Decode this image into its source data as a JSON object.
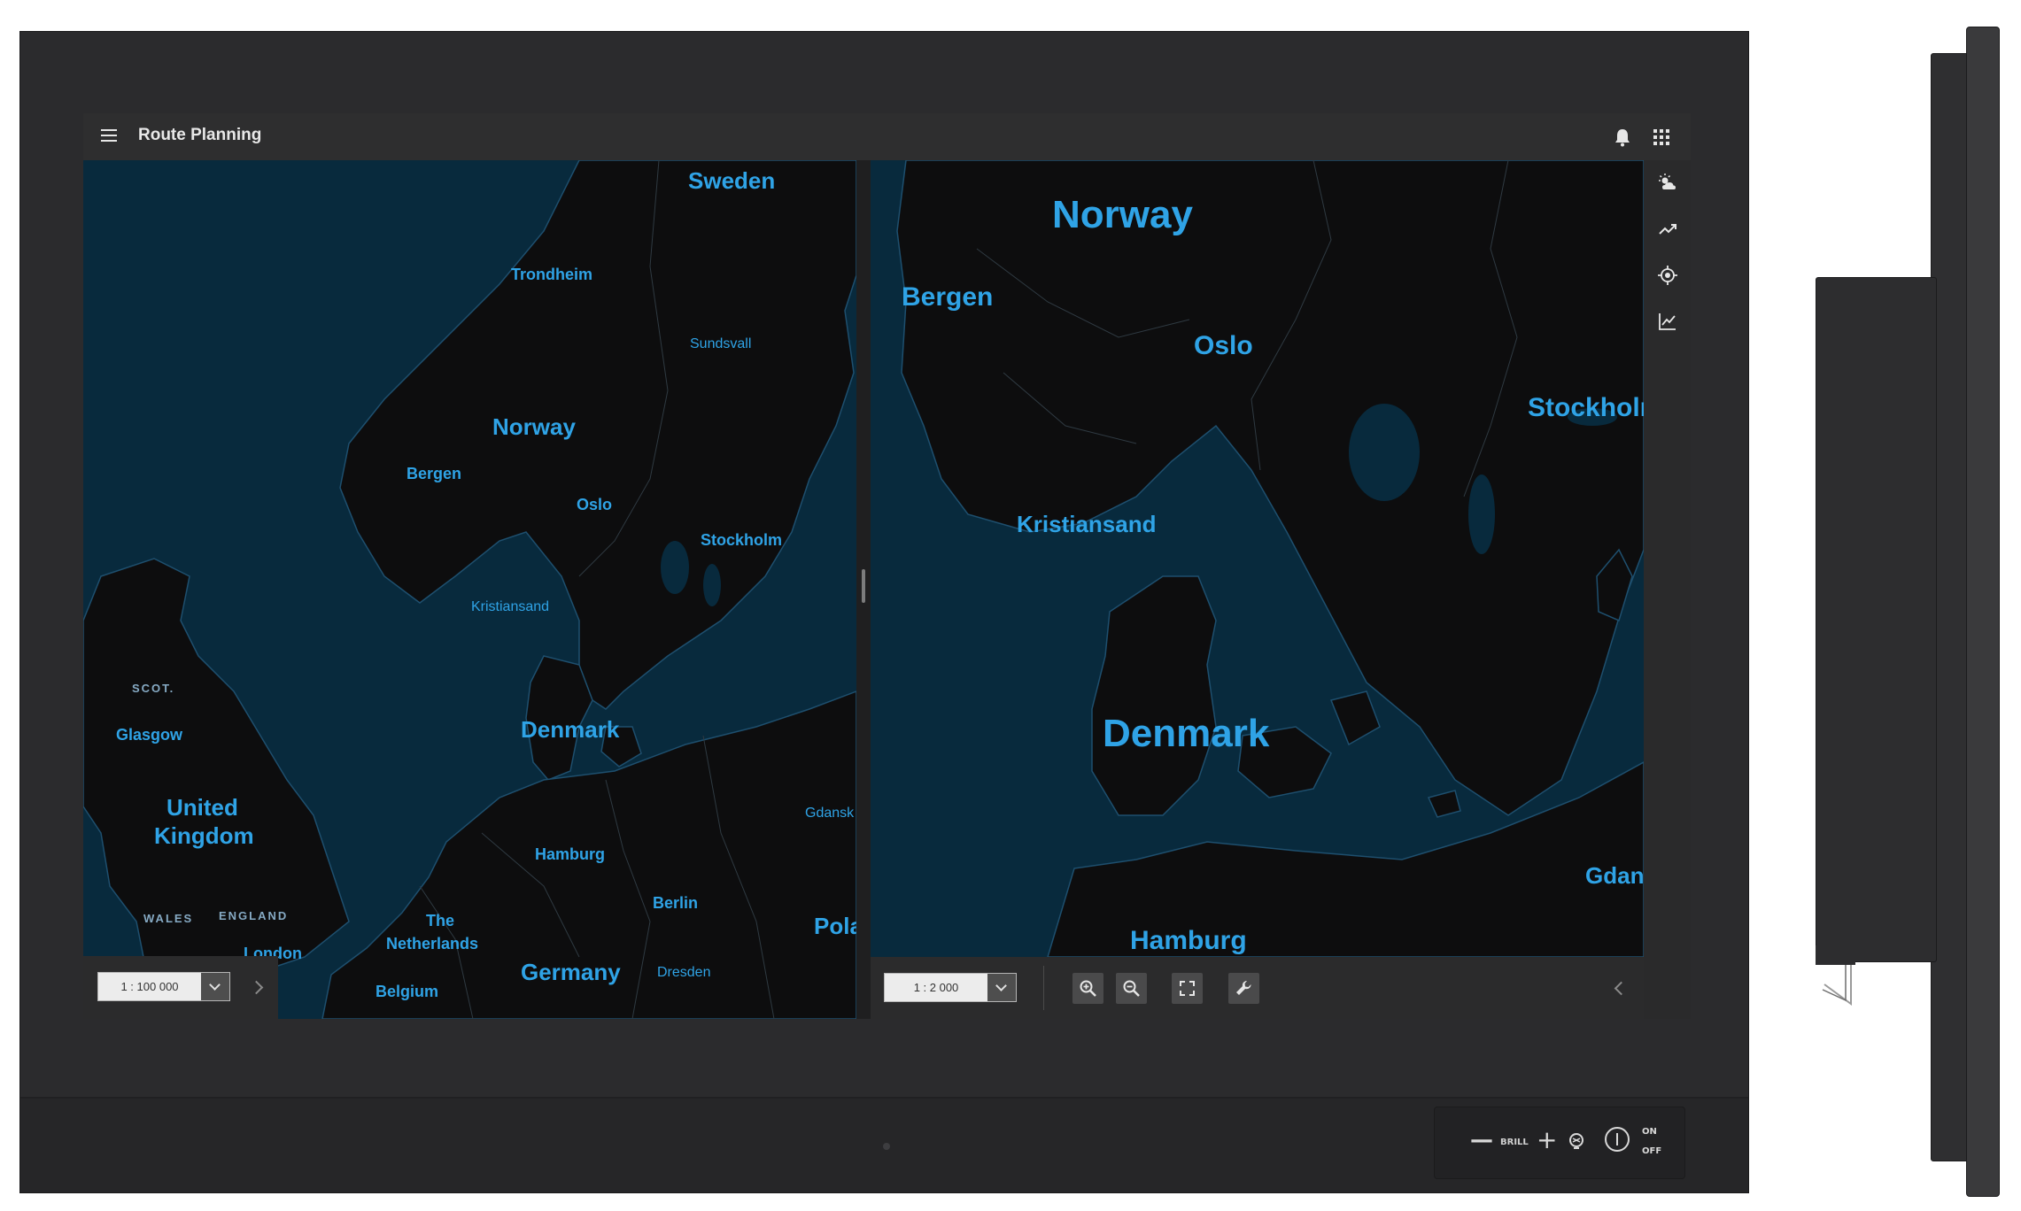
{
  "app": {
    "title": "Route Planning"
  },
  "left_map": {
    "scale": "1 : 100 000",
    "labels": {
      "sweden": "Sweden",
      "trondheim": "Trondheim",
      "sundsvall": "Sundsvall",
      "norway": "Norway",
      "bergen": "Bergen",
      "oslo": "Oslo",
      "stockholm": "Stockholm",
      "kristiansand": "Kristiansand",
      "scot": "SCOT.",
      "glasgow": "Glasgow",
      "denmark": "Denmark",
      "uk_line1": "United",
      "uk_line2": "Kingdom",
      "gdansk": "Gdansk",
      "hamburg": "Hamburg",
      "wales": "WALES",
      "england": "ENGLAND",
      "nl_line1": "The",
      "nl_line2": "Netherlands",
      "berlin": "Berlin",
      "poland": "Pola",
      "london": "London",
      "germany": "Germany",
      "dresden": "Dresden",
      "belgium": "Belgium"
    }
  },
  "right_map": {
    "scale": "1 : 2 000",
    "labels": {
      "norway": "Norway",
      "bergen": "Bergen",
      "oslo": "Oslo",
      "stockholm": "Stockholn",
      "kristiansand": "Kristiansand",
      "denmark": "Denmark",
      "gdansk": "Gdan",
      "hamburg": "Hamburg"
    }
  },
  "hardware": {
    "brill_label": "BRILL",
    "on_label": "ON",
    "off_label": "OFF"
  },
  "icons": {
    "header": [
      "menu-icon",
      "bell-icon",
      "apps-grid-icon"
    ],
    "toolbar": [
      "weather-icon",
      "trend-line-icon",
      "gps-target-icon",
      "chart-icon"
    ],
    "bottom": [
      "zoom-in-icon",
      "zoom-out-icon",
      "fullscreen-icon",
      "wrench-icon"
    ]
  },
  "colors": {
    "sea": "#082a3d",
    "land": "#0d0d0e",
    "label": "#2fa3e6",
    "header": "#2e2e2f",
    "bezel": "#2b2b2d"
  }
}
